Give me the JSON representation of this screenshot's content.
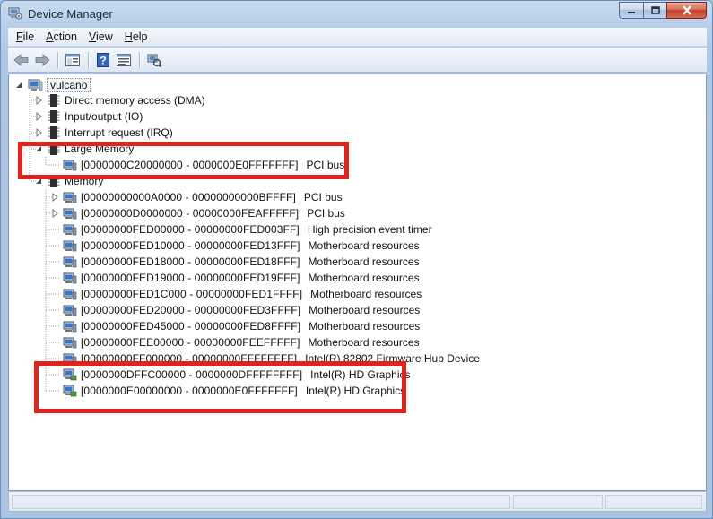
{
  "window": {
    "title": "Device Manager"
  },
  "menubar": {
    "items": [
      {
        "label": "File",
        "key": "F",
        "rest": "ile"
      },
      {
        "label": "Action",
        "key": "A",
        "rest": "ction"
      },
      {
        "label": "View",
        "key": "V",
        "rest": "iew"
      },
      {
        "label": "Help",
        "key": "H",
        "rest": "elp"
      }
    ]
  },
  "toolbar": {
    "buttons": [
      "back-arrow-icon",
      "forward-arrow-icon",
      "properties-grid-icon",
      "help-icon",
      "show-hide-tree-icon",
      "scan-hardware-icon"
    ]
  },
  "tree": {
    "root": "vulcano",
    "categories": [
      {
        "label": "Direct memory access (DMA)",
        "expanded": false
      },
      {
        "label": "Input/output (IO)",
        "expanded": false
      },
      {
        "label": "Interrupt request (IRQ)",
        "expanded": false
      },
      {
        "label": "Large Memory",
        "expanded": true
      },
      {
        "label": "Memory",
        "expanded": true
      }
    ],
    "large_memory_items": [
      {
        "range": "[0000000C20000000 - 0000000E0FFFFFFF]",
        "device": "PCI bus"
      }
    ],
    "memory_items": [
      {
        "range": "[00000000000A0000 - 00000000000BFFFF]",
        "device": "PCI bus",
        "expandable": true
      },
      {
        "range": "[00000000D0000000 - 00000000FEAFFFFF]",
        "device": "PCI bus",
        "expandable": true
      },
      {
        "range": "[00000000FED00000 - 00000000FED003FF]",
        "device": "High precision event timer",
        "expandable": false
      },
      {
        "range": "[00000000FED10000 - 00000000FED13FFF]",
        "device": "Motherboard resources",
        "expandable": false
      },
      {
        "range": "[00000000FED18000 - 00000000FED18FFF]",
        "device": "Motherboard resources",
        "expandable": false
      },
      {
        "range": "[00000000FED19000 - 00000000FED19FFF]",
        "device": "Motherboard resources",
        "expandable": false
      },
      {
        "range": "[00000000FED1C000 - 00000000FED1FFFF]",
        "device": "Motherboard resources",
        "expandable": false
      },
      {
        "range": "[00000000FED20000 - 00000000FED3FFFF]",
        "device": "Motherboard resources",
        "expandable": false
      },
      {
        "range": "[00000000FED45000 - 00000000FED8FFFF]",
        "device": "Motherboard resources",
        "expandable": false
      },
      {
        "range": "[00000000FEE00000 - 00000000FEEFFFFF]",
        "device": "Motherboard resources",
        "expandable": false
      },
      {
        "range": "[00000000FF000000 - 00000000FFFFFFFF]",
        "device": "Intel(R) 82802 Firmware Hub Device",
        "expandable": false
      },
      {
        "range": "[0000000DFFC00000 - 0000000DFFFFFFFF]",
        "device": "Intel(R) HD Graphics",
        "expandable": false
      },
      {
        "range": "[0000000E00000000 - 0000000E0FFFFFFF]",
        "device": "Intel(R) HD Graphics",
        "expandable": false
      }
    ]
  },
  "colors": {
    "highlight": "#e2231d",
    "titlebar": "#c9dbef"
  }
}
